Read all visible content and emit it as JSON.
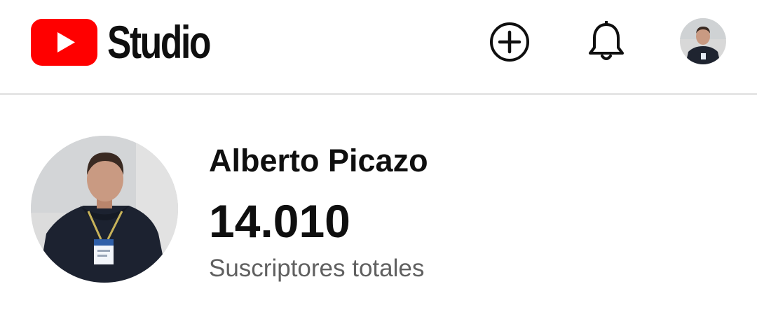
{
  "header": {
    "app_name": "Studio",
    "icons": {
      "logo": "youtube-play-logo-icon",
      "create": "add-circle-icon",
      "notifications": "bell-icon",
      "account": "account-avatar"
    }
  },
  "channel": {
    "name": "Alberto Picazo",
    "subscriber_count": "14.010",
    "subscriber_label": "Suscriptores totales"
  },
  "colors": {
    "brand_red": "#ff0000",
    "text_primary": "#0f0f0f",
    "text_secondary": "#606060",
    "divider": "#e5e5e5"
  }
}
